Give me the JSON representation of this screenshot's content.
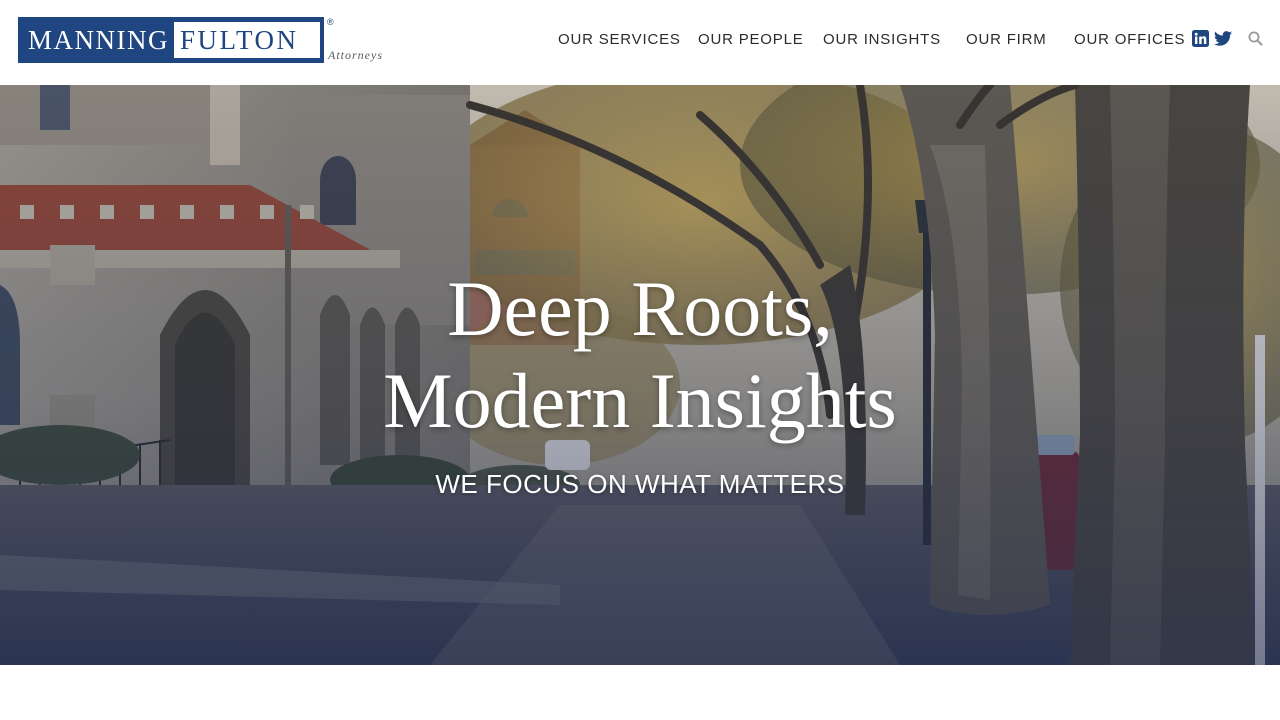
{
  "brand": {
    "name_part1": "MANNING",
    "name_part2": "FULTON",
    "registered": "®",
    "tagline": "Attorneys",
    "colors": {
      "brand_blue": "#1f4680"
    }
  },
  "nav": {
    "items": [
      {
        "label": "OUR SERVICES"
      },
      {
        "label": "OUR PEOPLE"
      },
      {
        "label": "OUR INSIGHTS"
      },
      {
        "label": "OUR FIRM"
      },
      {
        "label": "OUR OFFICES"
      }
    ],
    "social": [
      {
        "icon": "linkedin-icon"
      },
      {
        "icon": "twitter-icon"
      }
    ],
    "search_icon": "search-icon"
  },
  "hero": {
    "title_line1": "Deep Roots,",
    "title_line2": "Modern Insights",
    "subtitle": "WE FOCUS ON WHAT MATTERS",
    "image": "photo: stone church and tree-lined street in autumn"
  }
}
